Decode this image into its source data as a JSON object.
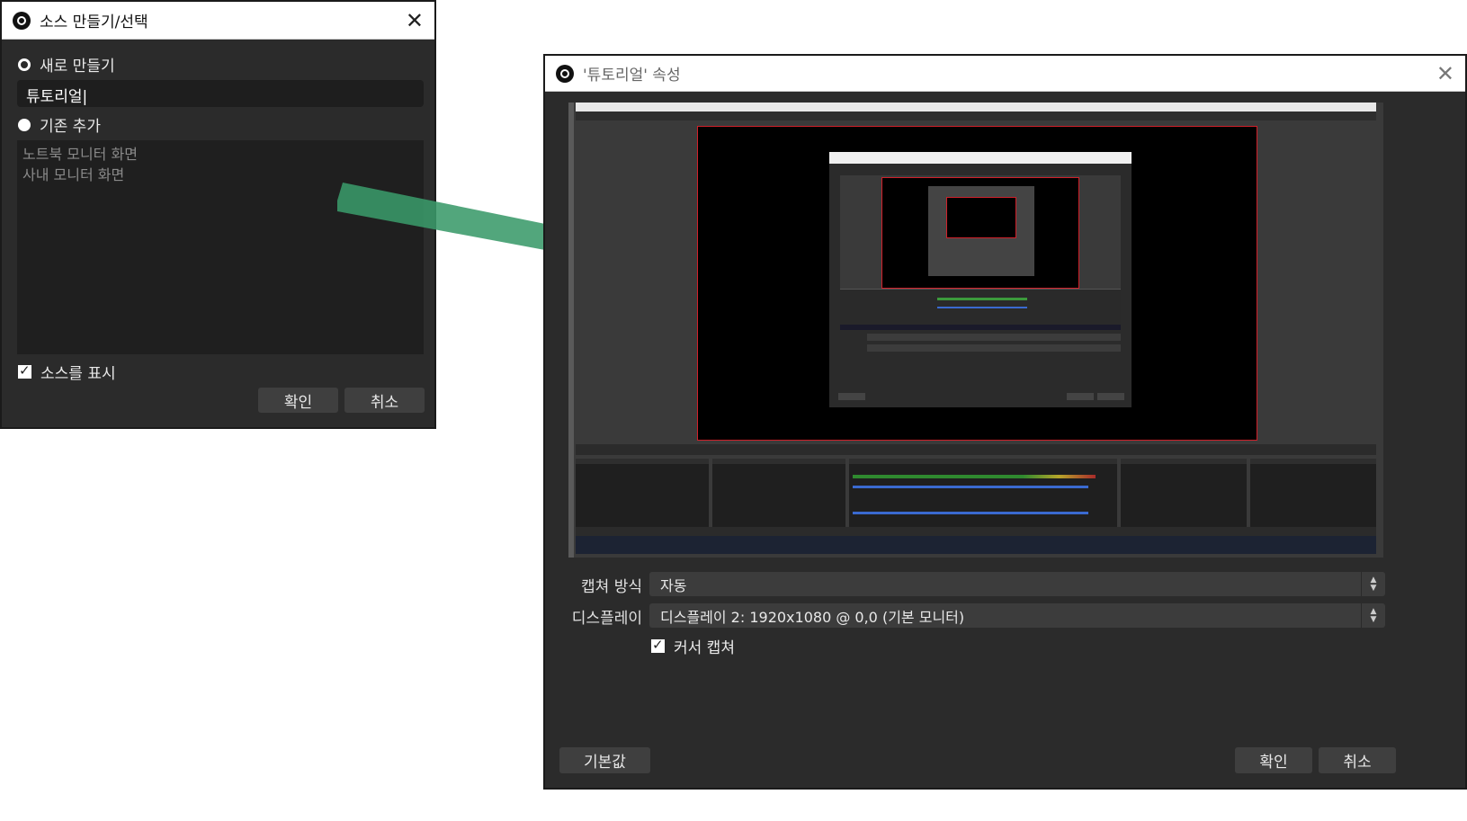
{
  "create_dialog": {
    "title": "소스 만들기/선택",
    "close_glyph": "✕",
    "radio_new_label": "새로 만들기",
    "name_value": "튜토리얼|",
    "radio_existing_label": "기존 추가",
    "existing_sources": [
      "노트북 모니터 화면",
      "사내 모니터 화면"
    ],
    "show_source_label": "소스를 표시",
    "ok_label": "확인",
    "cancel_label": "취소"
  },
  "properties_dialog": {
    "title": "'튜토리얼' 속성",
    "close_glyph": "✕",
    "capture_method_label": "캡쳐 방식",
    "capture_method_value": "자동",
    "display_label": "디스플레이",
    "display_value": "디스플레이 2: 1920x1080 @ 0,0 (기본 모니터)",
    "capture_cursor_label": "커서 캡쳐",
    "defaults_label": "기본값",
    "ok_label": "확인",
    "cancel_label": "취소"
  },
  "colors": {
    "arrow": "#3a9a6a",
    "selection_border": "#d0202a",
    "dialog_bg": "#2b2b2b"
  },
  "icons": {
    "obs_logo": "obs-logo-icon",
    "arrow": "right-arrow-icon"
  }
}
